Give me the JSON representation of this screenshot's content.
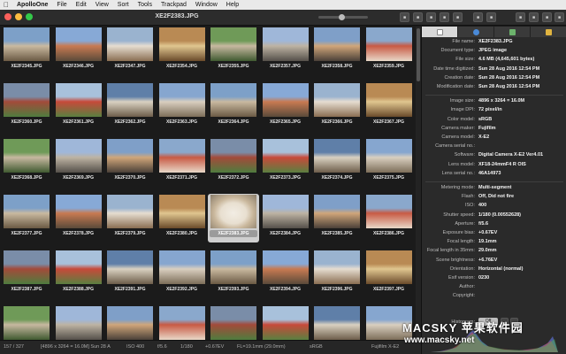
{
  "menubar": {
    "app": "ApolloOne",
    "items": [
      "File",
      "Edit",
      "View",
      "Sort",
      "Tools",
      "Trackpad",
      "Window",
      "Help"
    ]
  },
  "window": {
    "title": "XE2F2383.JPG"
  },
  "colors": {
    "accent_selected": "#cfcfcf",
    "panel_bg": "#2a2a2a",
    "grid_bg": "#1b1b1b"
  },
  "thumbnails": [
    "XE2F2345.JPG",
    "XE2F2346.JPG",
    "XE2F2347.JPG",
    "XE2F2354.JPG",
    "XE2F2355.JPG",
    "XE2F2357.JPG",
    "XE2F2358.JPG",
    "XE2F2359.JPG",
    "XE2F2360.JPG",
    "XE2F2361.JPG",
    "XE2F2362.JPG",
    "XE2F2363.JPG",
    "XE2F2364.JPG",
    "XE2F2365.JPG",
    "XE2F2366.JPG",
    "XE2F2367.JPG",
    "XE2F2368.JPG",
    "XE2F2369.JPG",
    "XE2F2370.JPG",
    "XE2F2371.JPG",
    "XE2F2372.JPG",
    "XE2F2373.JPG",
    "XE2F2374.JPG",
    "XE2F2375.JPG",
    "XE2F2377.JPG",
    "XE2F2378.JPG",
    "XE2F2379.JPG",
    "XE2F2380.JPG",
    "XE2F2383.JPG",
    "XE2F2384.JPG",
    "XE2F2385.JPG",
    "XE2F2386.JPG",
    "XE2F2387.JPG",
    "XE2F2388.JPG",
    "XE2F2391.JPG",
    "XE2F2392.JPG",
    "XE2F2393.JPG",
    "XE2F2394.JPG",
    "XE2F2396.JPG",
    "XE2F2397.JPG",
    "",
    "",
    "",
    "",
    "",
    "",
    "",
    ""
  ],
  "selected_index": 28,
  "status": {
    "count": "157 / 327",
    "dims": "[4896 x 3264 = 16.0M] Sun 28 A",
    "iso": "ISO 400",
    "aperture": "f/5.6",
    "shutter": "1/180",
    "ev": "+0.67EV",
    "focal": "FL=19.1mm (29.0mm)",
    "color": "sRGB",
    "camera": "Fujifilm X-E2"
  },
  "metadata": [
    {
      "k": "File name:",
      "v": "XE2F2383.JPG"
    },
    {
      "k": "Document type:",
      "v": "JPEG image"
    },
    {
      "k": "File size:",
      "v": "4.6 MB (4,645,601 bytes)"
    },
    {
      "k": "Date time digitized:",
      "v": "Sun 28 Aug 2016  12:54 PM"
    },
    {
      "k": "Creation date:",
      "v": "Sun 28 Aug 2016  12:54 PM"
    },
    {
      "k": "Modification date:",
      "v": "Sun 28 Aug 2016  12:54 PM"
    },
    {
      "sep": true
    },
    {
      "k": "Image size:",
      "v": "4896 x 3264 = 16.0M"
    },
    {
      "k": "Image DPI:",
      "v": "72 pixel/in"
    },
    {
      "k": "Color model:",
      "v": "sRGB"
    },
    {
      "k": "Camera maker:",
      "v": "Fujifilm"
    },
    {
      "k": "Camera model:",
      "v": "X-E2"
    },
    {
      "k": "Camera serial no.:",
      "v": ""
    },
    {
      "k": "Software:",
      "v": "Digital Camera X-E2 Ver4.01"
    },
    {
      "k": "Lens model:",
      "v": "XF18-24mmF4 R OIS"
    },
    {
      "k": "Lens serial no.:",
      "v": "46A14973"
    },
    {
      "sep": true
    },
    {
      "k": "Metering mode:",
      "v": "Multi-segment"
    },
    {
      "k": "Flash:",
      "v": "Off, Did not fire"
    },
    {
      "k": "ISO:",
      "v": "400"
    },
    {
      "k": "Shutter speed:",
      "v": "1/180 (0.00552628)"
    },
    {
      "k": "Aperture:",
      "v": "f/5.6"
    },
    {
      "k": "Exposure bias:",
      "v": "+0.67EV"
    },
    {
      "k": "Focal length:",
      "v": "19.1mm"
    },
    {
      "k": "Focal length in 35mm:",
      "v": "29.0mm"
    },
    {
      "k": "Scene brightness:",
      "v": "+6.76EV"
    },
    {
      "k": "Orientation:",
      "v": "Horizontal (normal)"
    },
    {
      "k": "Exif version:",
      "v": "0230"
    },
    {
      "k": "Author:",
      "v": ""
    },
    {
      "k": "Copyright:",
      "v": ""
    }
  ],
  "histogram": {
    "label": "Histogram:",
    "toggle": "Off"
  },
  "watermark": {
    "line1": "MACSKY 苹果软件园",
    "line2": "www.macsky.net"
  }
}
